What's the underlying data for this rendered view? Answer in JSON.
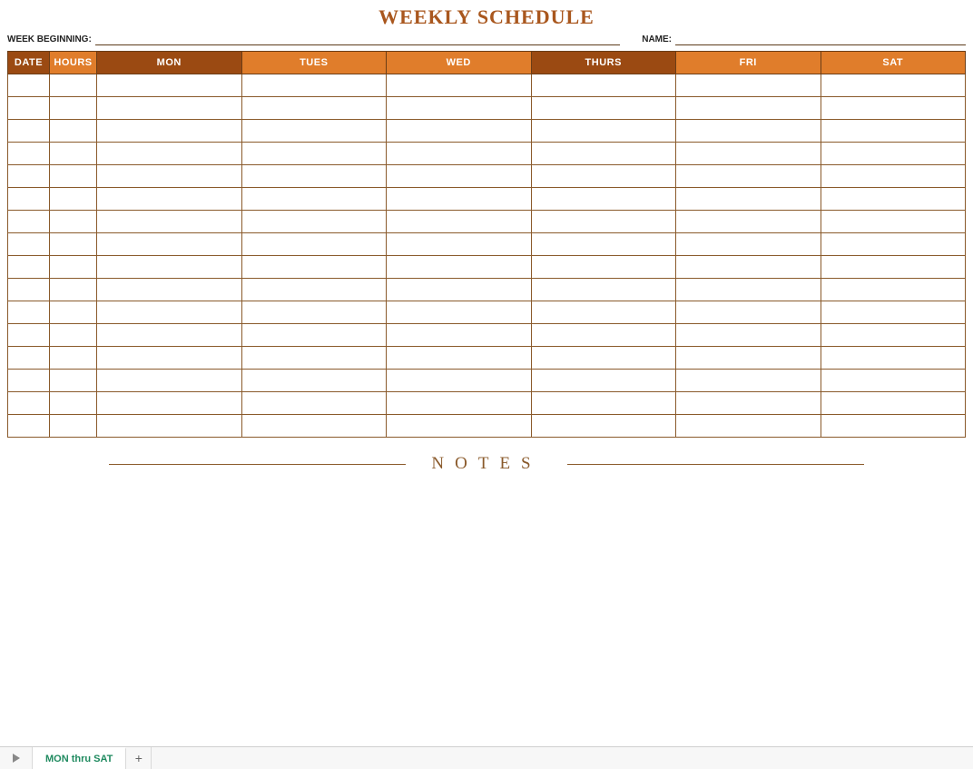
{
  "title": "WEEKLY SCHEDULE",
  "meta": {
    "week_label": "WEEK BEGINNING:",
    "week_value": "",
    "name_label": "NAME:",
    "name_value": ""
  },
  "columns": [
    {
      "key": "date",
      "label": "DATE",
      "bg": "#9b4a12"
    },
    {
      "key": "hours",
      "label": "HOURS",
      "bg": "#e07d2b"
    },
    {
      "key": "mon",
      "label": "MON",
      "bg": "#9b4a12"
    },
    {
      "key": "tues",
      "label": "TUES",
      "bg": "#e07d2b"
    },
    {
      "key": "wed",
      "label": "WED",
      "bg": "#e07d2b"
    },
    {
      "key": "thurs",
      "label": "THURS",
      "bg": "#9b4a12"
    },
    {
      "key": "fri",
      "label": "FRI",
      "bg": "#e07d2b"
    },
    {
      "key": "sat",
      "label": "SAT",
      "bg": "#e07d2b"
    }
  ],
  "row_count": 16,
  "notes_label": "NOTES",
  "tabs": {
    "active": "MON thru SAT"
  }
}
